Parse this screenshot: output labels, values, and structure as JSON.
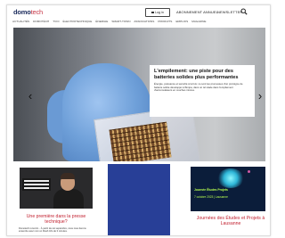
{
  "header": {
    "logo_main": "domo",
    "logo_accent": "tech",
    "login_label": "Log in",
    "subscribe_label": "ABONNEMENT ANNUEL",
    "newsletter_label": "NEWSLETTER",
    "search_icon": "search-icon"
  },
  "nav": {
    "items": [
      "ACTUALITÉS",
      "DOMOTÉCH",
      "TVOI",
      "ÉLECTROTECHNIQUE",
      "ÉNERGIE",
      "SMART-TOWN",
      "ASSOCIATIONS",
      "PRODUITS",
      "EMPLOIS",
      "MAGAZINE"
    ]
  },
  "hero": {
    "title": "L'empilement: une piste pour des batteries solides plus performantes",
    "text": "Énergie, puissance et sécurité à la fois: ce sont les promesses d'un prototype de batterie solide développé à l'Empa, dans un tel stade dans l'empilement d'accumulateurs en couches minces.",
    "prev_icon": "chevron-left-icon",
    "next_icon": "chevron-right-icon"
  },
  "cards": [
    {
      "title": "Une première dans la presse technique?",
      "meta": "Domotech rencontr...\nÀ partir de cet septembre, nous nous lierons ensembe avec mon un Flash Info de 3 minutes."
    },
    {
      "title": ""
    },
    {
      "poster_title": "Journée Études Projets",
      "poster_date": "7 octobre 2023 | Lausanne",
      "title": "Journées des Études et Projets à Lausanne"
    }
  ],
  "colors": {
    "accent_red": "#c21f2e",
    "navy": "#1d2d5e",
    "card_blue": "#283f97"
  }
}
